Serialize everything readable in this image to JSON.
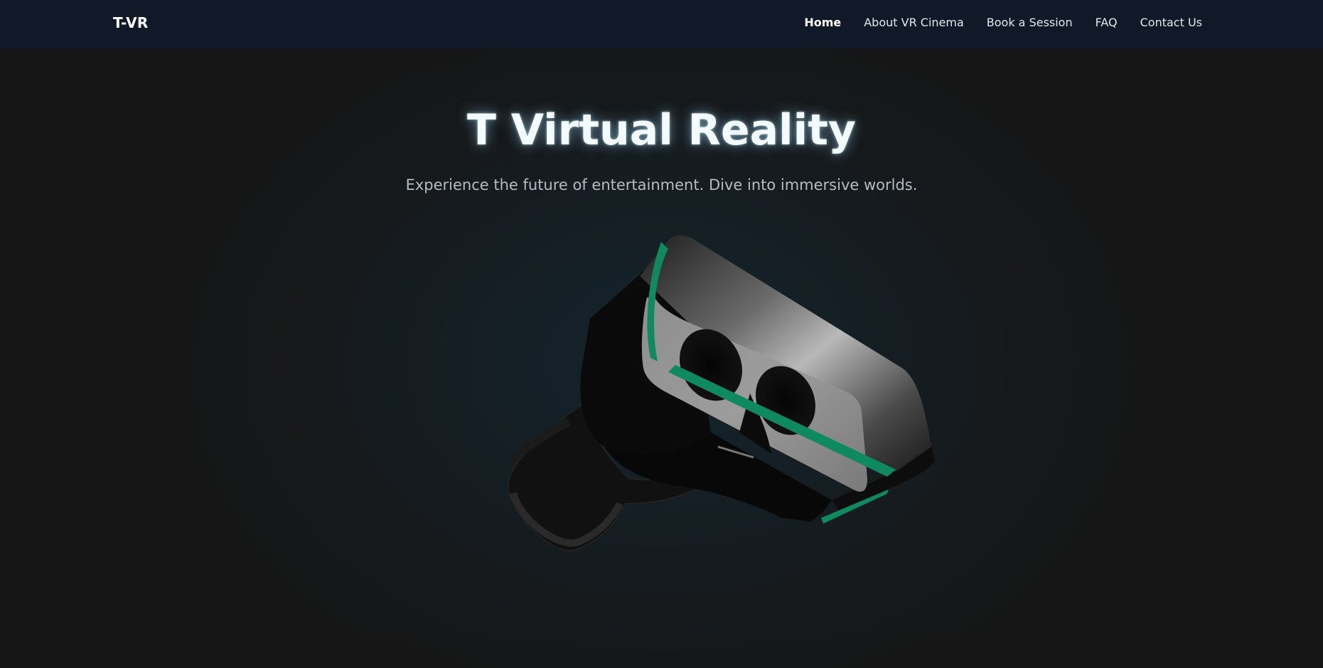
{
  "nav": {
    "brand": "T-VR",
    "links": [
      {
        "label": "Home",
        "active": true
      },
      {
        "label": "About VR Cinema",
        "active": false
      },
      {
        "label": "Book a Session",
        "active": false
      },
      {
        "label": "FAQ",
        "active": false
      },
      {
        "label": "Contact Us",
        "active": false
      }
    ]
  },
  "hero": {
    "title": "T Virtual Reality",
    "subtitle": "Experience the future of entertainment. Dive into immersive worlds.",
    "image": "vr-headset"
  },
  "colors": {
    "navbar_bg": "#111827",
    "page_bg": "#161616",
    "accent_green": "#0f8a60",
    "title_glow": "#a0dcff"
  }
}
